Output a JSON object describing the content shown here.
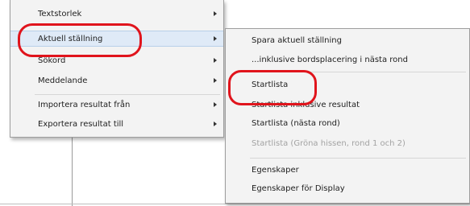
{
  "left_menu": {
    "items": [
      {
        "label": "Textstorlek"
      },
      {
        "label": "Aktuell ställning"
      },
      {
        "label": "Sökord"
      },
      {
        "label": "Meddelande"
      },
      {
        "label": "Importera resultat från"
      },
      {
        "label": "Exportera resultat till"
      }
    ]
  },
  "right_menu": {
    "items": [
      {
        "label": "Spara aktuell ställning"
      },
      {
        "label": "...inklusive bordsplacering i nästa rond"
      },
      {
        "label": "Startlista"
      },
      {
        "label": "Startlista inklusive resultat"
      },
      {
        "label": "Startlista (nästa rond)"
      },
      {
        "label": "Startlista (Gröna hissen, rond 1 och 2)"
      },
      {
        "label": "Egenskaper"
      },
      {
        "label": "Egenskaper för Display"
      }
    ]
  },
  "colors": {
    "highlight_circle": "#e0141c",
    "hover_bg": "#dfeaf7"
  }
}
